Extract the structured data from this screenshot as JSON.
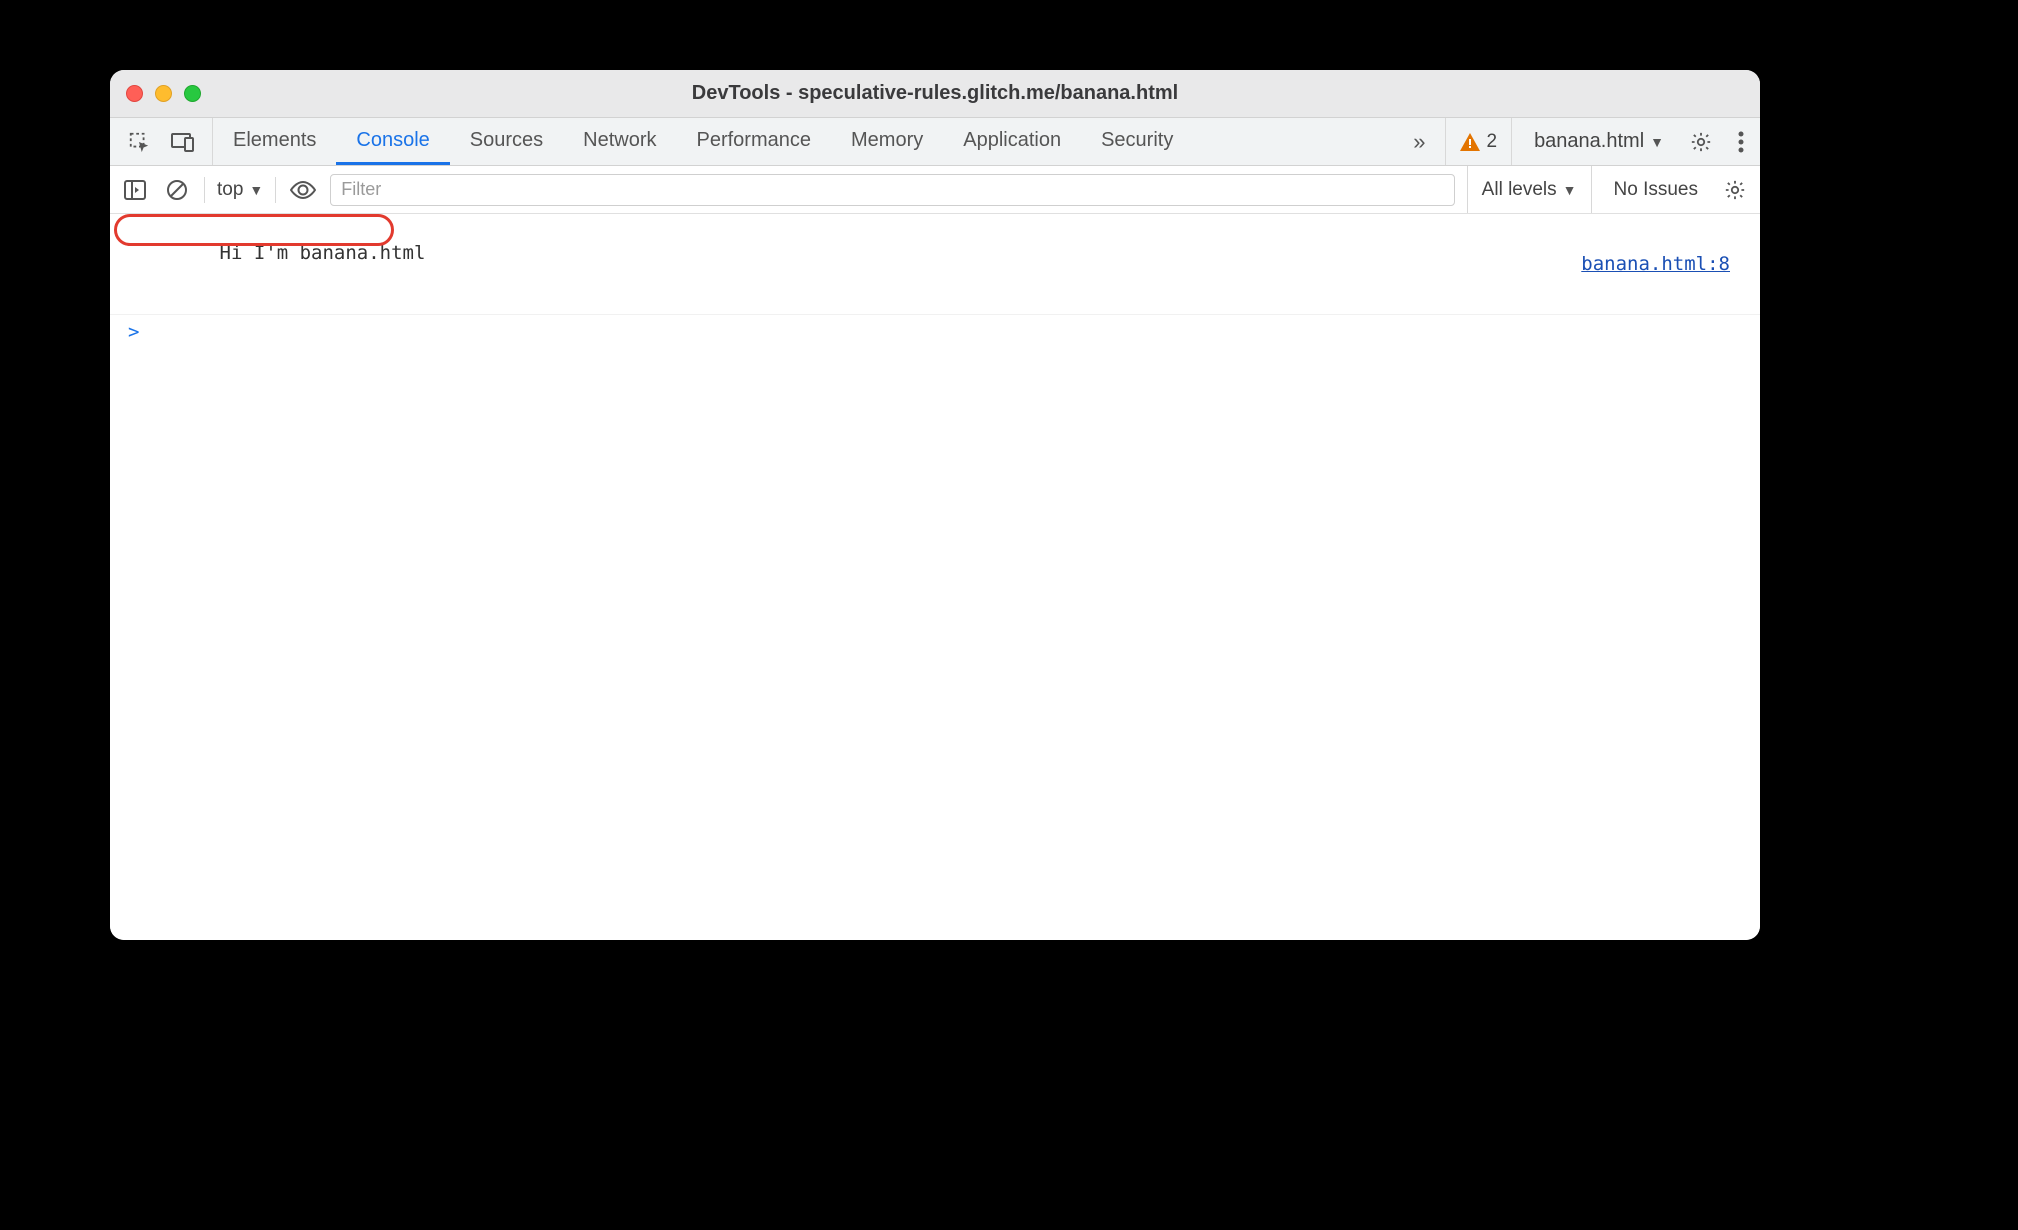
{
  "window": {
    "title": "DevTools - speculative-rules.glitch.me/banana.html"
  },
  "tabs": {
    "items": [
      "Elements",
      "Console",
      "Sources",
      "Network",
      "Performance",
      "Memory",
      "Application",
      "Security"
    ],
    "active": "Console",
    "overflow_glyph": "»",
    "warning_count": "2",
    "frame_selector": "banana.html"
  },
  "toolbar": {
    "context": "top",
    "filter_placeholder": "Filter",
    "levels_label": "All levels",
    "issues_label": "No Issues"
  },
  "console": {
    "rows": [
      {
        "message": "Hi I'm banana.html",
        "source": "banana.html:8",
        "highlighted": true
      }
    ],
    "prompt": ">"
  }
}
